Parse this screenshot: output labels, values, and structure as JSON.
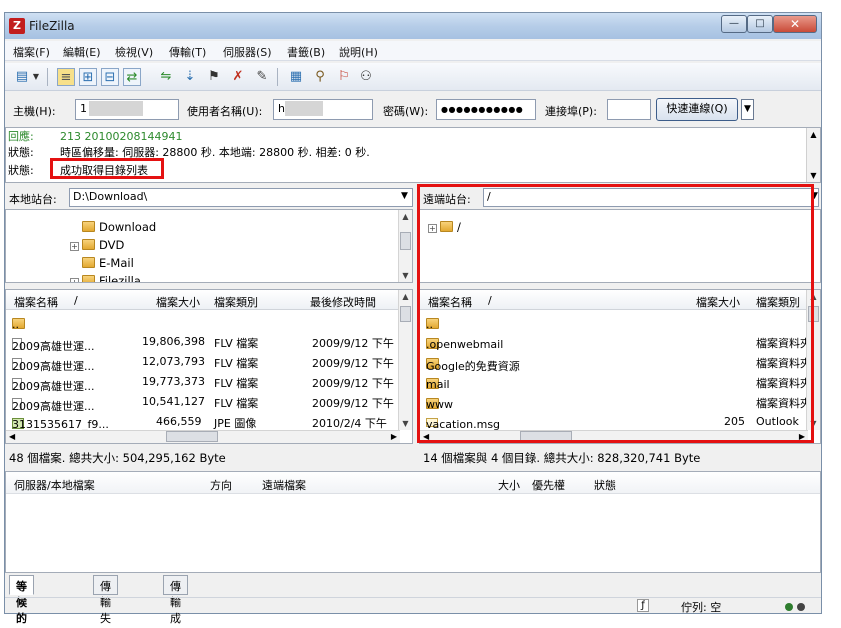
{
  "window": {
    "title": "FileZilla",
    "app_icon_letter": "Z"
  },
  "menu": [
    "檔案(F)",
    "編輯(E)",
    "檢視(V)",
    "傳輸(T)",
    "伺服器(S)",
    "書籤(B)",
    "說明(H)"
  ],
  "quickconnect": {
    "host_label": "主機(H):",
    "host_value": "1",
    "user_label": "使用者名稱(U):",
    "user_value": "h",
    "password_label": "密碼(W):",
    "password_value": "●●●●●●●●●●●",
    "port_label": "連接埠(P):",
    "port_value": "",
    "button_label": "快速連線(Q)"
  },
  "log": [
    {
      "key": "回應:",
      "text": "213 20100208144941",
      "color": "green"
    },
    {
      "key": "狀態:",
      "text": "時區偏移量: 伺服器: 28800 秒. 本地端: 28800 秒. 相差: 0 秒.",
      "color": "black"
    },
    {
      "key": "狀態:",
      "text": "成功取得目錄列表",
      "color": "black"
    }
  ],
  "local": {
    "site_label": "本地站台:",
    "site_path": "D:\\Download\\",
    "tree": [
      "Download",
      "DVD",
      "E-Mail",
      "Filezilla"
    ],
    "columns": [
      "檔案名稱",
      "/",
      "檔案大小",
      "檔案類別",
      "最後修改時間"
    ],
    "files": [
      {
        "name": "..",
        "size": "",
        "type": "",
        "modified": "",
        "icon": "folder"
      },
      {
        "name": "2009高雄世運...",
        "size": "19,806,398",
        "type": "FLV 檔案",
        "modified": "2009/9/12 下午",
        "icon": "file"
      },
      {
        "name": "2009高雄世運...",
        "size": "12,073,793",
        "type": "FLV 檔案",
        "modified": "2009/9/12 下午",
        "icon": "file"
      },
      {
        "name": "2009高雄世運...",
        "size": "19,773,373",
        "type": "FLV 檔案",
        "modified": "2009/9/12 下午",
        "icon": "file"
      },
      {
        "name": "2009高雄世運...",
        "size": "10,541,127",
        "type": "FLV 檔案",
        "modified": "2009/9/12 下午",
        "icon": "file"
      },
      {
        "name": "3131535617_f9...",
        "size": "466,559",
        "type": "JPE 圖像",
        "modified": "2010/2/4 下午",
        "icon": "image"
      }
    ],
    "status": "48 個檔案. 總共大小: 504,295,162 Byte"
  },
  "remote": {
    "site_label": "遠端站台:",
    "site_path": "/",
    "tree": [
      "/"
    ],
    "columns": [
      "檔案名稱",
      "/",
      "檔案大小",
      "檔案類別"
    ],
    "files": [
      {
        "name": "..",
        "size": "",
        "type": "",
        "icon": "folder"
      },
      {
        "name": ".openwebmail",
        "size": "",
        "type": "檔案資料夾",
        "icon": "folder"
      },
      {
        "name": "Google的免費資源",
        "size": "",
        "type": "檔案資料夾",
        "icon": "folder"
      },
      {
        "name": "mail",
        "size": "",
        "type": "檔案資料夾",
        "icon": "folder"
      },
      {
        "name": "www",
        "size": "",
        "type": "檔案資料夾",
        "icon": "folder"
      },
      {
        "name": "vacation.msg",
        "size": "205",
        "type": "Outlook",
        "icon": "mail"
      }
    ],
    "status": "14 個檔案與 4 個目錄. 總共大小: 828,320,741 Byte"
  },
  "queue": {
    "columns": [
      "伺服器/本地檔案",
      "方向",
      "遠端檔案",
      "大小",
      "優先權",
      "狀態"
    ],
    "tabs": [
      "等候的檔案",
      "傳輸失敗",
      "傳輸成功"
    ],
    "status_text": "佇列: 空"
  },
  "colors": {
    "highlight": "#e41111",
    "log_green": "#2d8a2d"
  }
}
